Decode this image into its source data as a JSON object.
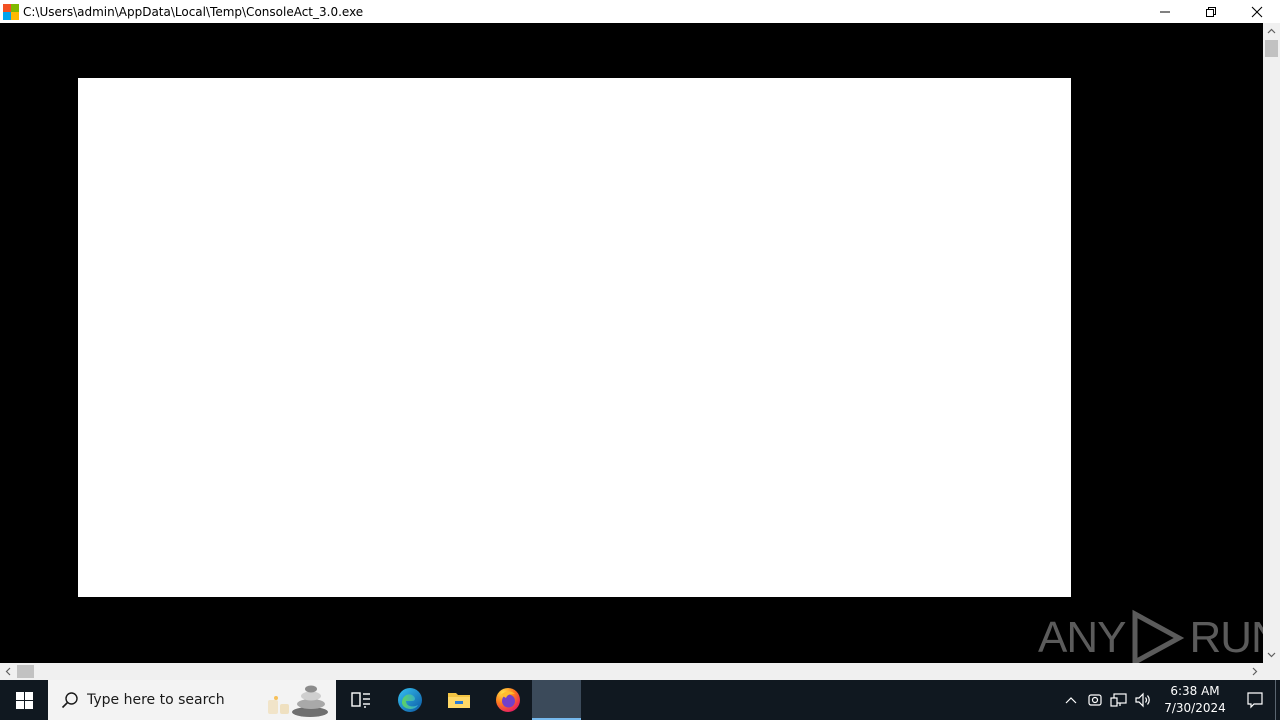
{
  "window": {
    "title": "C:\\Users\\admin\\AppData\\Local\\Temp\\ConsoleAct_3.0.exe",
    "controls": [
      "minimize",
      "restore",
      "close"
    ]
  },
  "watermark": {
    "left_text": "ANY",
    "right_text": "RUN"
  },
  "taskbar": {
    "search_placeholder": "Type here to search",
    "pinned": [
      {
        "name": "task-view",
        "icon": "task-view-icon"
      },
      {
        "name": "edge",
        "icon": "edge-icon"
      },
      {
        "name": "file-explorer",
        "icon": "folder-icon"
      },
      {
        "name": "firefox",
        "icon": "firefox-icon"
      },
      {
        "name": "console-app",
        "icon": "console-app-icon",
        "active": true
      }
    ],
    "clock": {
      "time": "6:38 AM",
      "date": "7/30/2024"
    }
  },
  "colors": {
    "taskbar_bg": "#101820",
    "console_bg": "#000000",
    "active_indicator": "#76b9ed"
  }
}
